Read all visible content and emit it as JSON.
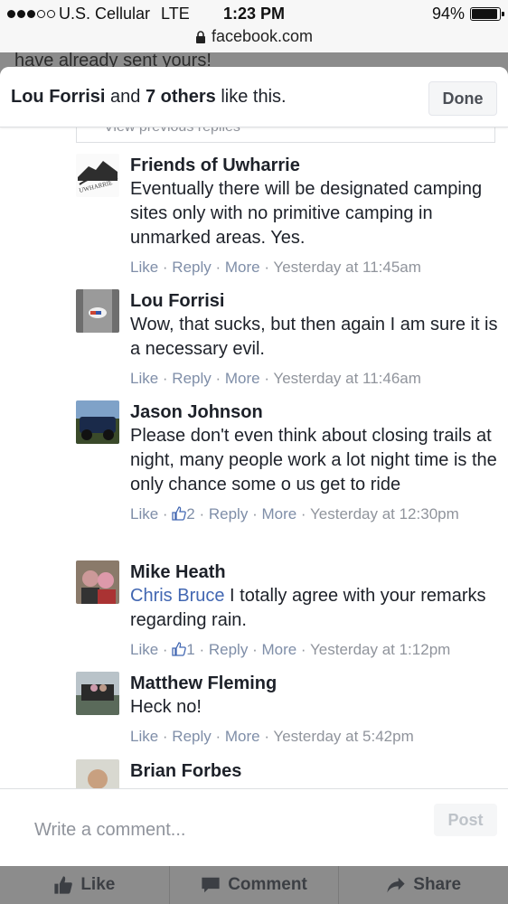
{
  "status_bar": {
    "carrier": "U.S. Cellular",
    "network": "LTE",
    "time": "1:23 PM",
    "battery": "94%"
  },
  "url": "facebook.com",
  "background_peek_text": "have already sent yours!",
  "likes_header": {
    "first_name": "Lou Forrisi",
    "conjunction": "and",
    "others": "7 others",
    "suffix": "like this.",
    "done_label": "Done"
  },
  "previous_replies_label": "View previous replies",
  "comments": [
    {
      "author": "Friends of Uwharrie",
      "text": "Eventually there will be designated camping sites only with no primitive camping in unmarked areas. Yes.",
      "like": "Like",
      "reply": "Reply",
      "more": "More",
      "timestamp": "Yesterday at 11:45am"
    },
    {
      "author": "Lou Forrisi",
      "text": "Wow, that sucks, but then again I am sure it is a necessary evil.",
      "like": "Like",
      "reply": "Reply",
      "more": "More",
      "timestamp": "Yesterday at 11:46am"
    },
    {
      "author": "Jason Johnson",
      "text": "Please don't even think about closing trails at night, many people work a lot night time is the only chance some o us get to ride",
      "like": "Like",
      "reactions": "2",
      "reply": "Reply",
      "more": "More",
      "timestamp": "Yesterday at 12:30pm"
    },
    {
      "author": "Mike Heath",
      "mention": "Chris Bruce",
      "text": "I totally agree with your remarks regarding rain.",
      "like": "Like",
      "reactions": "1",
      "reply": "Reply",
      "more": "More",
      "timestamp": "Yesterday at 1:12pm"
    },
    {
      "author": "Matthew Fleming",
      "text": "Heck no!",
      "like": "Like",
      "reply": "Reply",
      "more": "More",
      "timestamp": "Yesterday at 5:42pm"
    },
    {
      "author": "Brian Forbes"
    }
  ],
  "composer": {
    "placeholder": "Write a comment...",
    "post_label": "Post"
  },
  "action_bar": {
    "like": "Like",
    "comment": "Comment",
    "share": "Share"
  },
  "colors": {
    "link_blue": "#4267b2",
    "meta_gray": "#90949c",
    "dim_overlay": "#8c8c8c"
  }
}
